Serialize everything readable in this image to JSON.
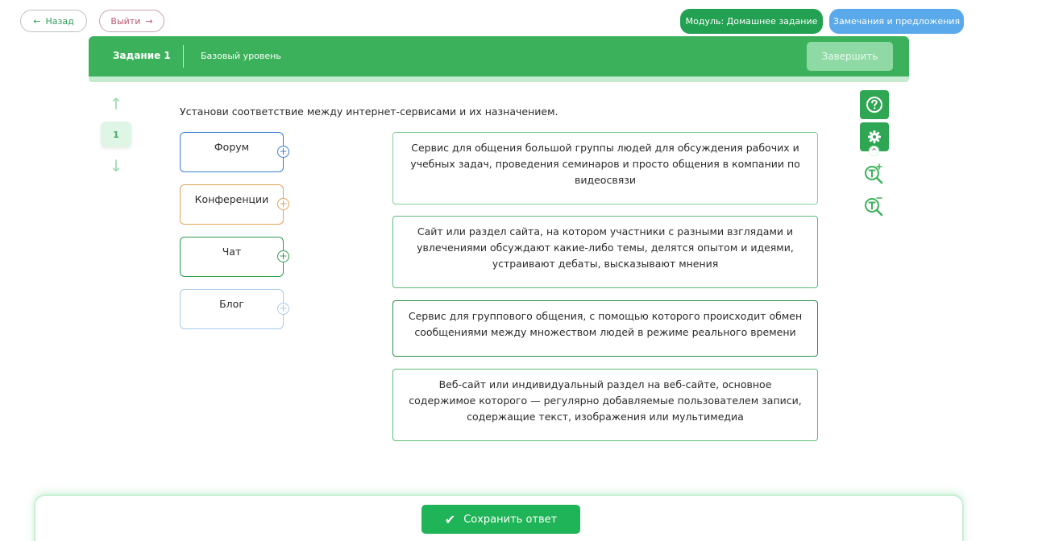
{
  "topbar": {
    "back_label": "Назад",
    "exit_label": "Выйти",
    "module_label": "Модуль: Домашнее задание",
    "feedback_label": "Замечания и предложения"
  },
  "task": {
    "title": "Задание 1",
    "level": "Базовый уровень",
    "finish_label": "Завершить"
  },
  "nav": {
    "current_number": "1"
  },
  "question": {
    "text": "Установи соответствие между интернет-сервисами и их назначением.",
    "terms": [
      "Форум",
      "Конференции",
      "Чат",
      "Блог"
    ],
    "definitions": [
      "Сервис для общения большой группы людей для обсуждения рабочих и учебных задач, проведения семинаров и просто общения в компании по видеосвязи",
      "Сайт или раздел сайта, на котором участники с разными взглядами и увлечениями обсуждают какие-либо темы, делятся опытом и идеями, устраивают дебаты, высказывают мнения",
      "Сервис для группового общения, с помощью которого происходит обмен сообщениями между множеством людей в режиме реального времени",
      "Веб-сайт или индивидуальный раздел на веб-сайте, основное содержимое которого — регулярно добавляемые пользователем записи, содержащие текст, изображения или мультимедиа"
    ]
  },
  "footer": {
    "save_label": "Сохранить ответ"
  },
  "colors": {
    "primary_green": "#3cb15b",
    "save_green": "#1fb457",
    "feedback_blue": "#5aa9ea"
  }
}
